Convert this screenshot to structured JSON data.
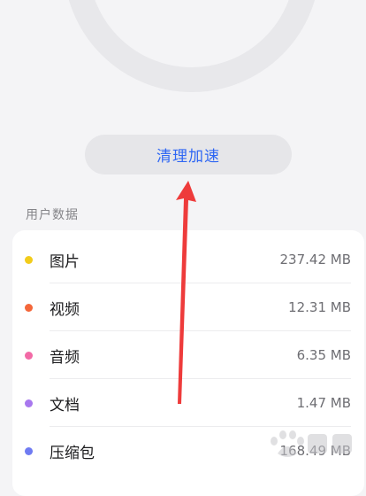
{
  "actions": {
    "clean_label": "清理加速"
  },
  "user_data": {
    "title": "用户数据",
    "items": [
      {
        "label": "图片",
        "size": "237.42 MB",
        "color": "#f2cc1b"
      },
      {
        "label": "视频",
        "size": "12.31 MB",
        "color": "#f4673a"
      },
      {
        "label": "音频",
        "size": "6.35 MB",
        "color": "#f26aa6"
      },
      {
        "label": "文档",
        "size": "1.47 MB",
        "color": "#a878ee"
      },
      {
        "label": "压缩包",
        "size": "168.49 MB",
        "color": "#6f7bf2"
      }
    ]
  },
  "colors": {
    "accent": "#2f67f3",
    "annotation_arrow": "#ee3b3b"
  },
  "icons": {
    "watermark": "baidu-paw-logo"
  }
}
